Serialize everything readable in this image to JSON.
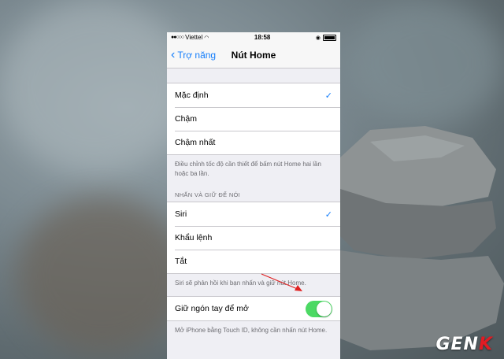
{
  "status_bar": {
    "carrier": "Viettel",
    "time": "18:58"
  },
  "nav": {
    "back_label": "Trợ năng",
    "title": "Nút Home"
  },
  "speed_group": {
    "options": [
      {
        "label": "Mặc định",
        "selected": true
      },
      {
        "label": "Chậm",
        "selected": false
      },
      {
        "label": "Chậm nhất",
        "selected": false
      }
    ],
    "footer": "Điều chỉnh tốc độ cần thiết để bấm nút Home hai lần hoặc ba lần."
  },
  "press_hold_group": {
    "header": "NHẤN VÀ GIỮ ĐỂ NÓI",
    "options": [
      {
        "label": "Siri",
        "selected": true
      },
      {
        "label": "Khẩu lệnh",
        "selected": false
      },
      {
        "label": "Tắt",
        "selected": false
      }
    ],
    "footer": "Siri sẽ phản hồi khi bạn nhấn và giữ nút Home."
  },
  "rest_finger_group": {
    "label": "Giữ ngón tay để mở",
    "enabled": true,
    "footer": "Mở iPhone bằng Touch ID, không cần nhấn nút Home."
  },
  "watermark": "GENK",
  "colors": {
    "accent": "#147efb",
    "toggle_on": "#4cd964",
    "arrow": "#e02020"
  }
}
